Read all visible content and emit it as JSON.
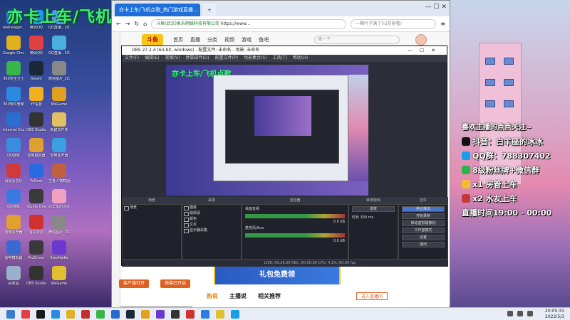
{
  "overlay": {
    "title": "亦卡上车/飞机点歌"
  },
  "desktop": {
    "icons": [
      {
        "label": "webviwger...",
        "color": "#2a7de1"
      },
      {
        "label": "腾讯QQ",
        "color": "#1a9de8"
      },
      {
        "label": "QQ直播...2021121...",
        "color": "#4aa0e0"
      },
      {
        "label": "Google Chrome",
        "color": "#e0b020"
      },
      {
        "label": "腾讯QQ",
        "color": "#e04040"
      },
      {
        "label": "QQ直播...2021121...",
        "color": "#4ab0e0"
      },
      {
        "label": "360安全卫士",
        "color": "#3ab54a"
      },
      {
        "label": "Steam",
        "color": "#1b2838"
      },
      {
        "label": "微信图片_2021...",
        "color": "#888888"
      },
      {
        "label": "360软件管家",
        "color": "#2a8ae0"
      },
      {
        "label": "YY语音",
        "color": "#f0b020"
      },
      {
        "label": "WeGame",
        "color": "#e0a020"
      },
      {
        "label": "Internet Explorer",
        "color": "#2a6ed0"
      },
      {
        "label": "OBS Studio",
        "color": "#333333"
      },
      {
        "label": "新建文件夹",
        "color": "#e0c060"
      },
      {
        "label": "QQ游戏",
        "color": "#3a8ee0"
      },
      {
        "label": "雷电模拟器",
        "color": "#e0a030"
      },
      {
        "label": "雷电多开器",
        "color": "#3aa0e0"
      },
      {
        "label": "网易云音乐",
        "color": "#d03a3a"
      },
      {
        "label": "ToDesk",
        "color": "#2a6ae0"
      },
      {
        "label": "王者人物截图",
        "color": "#c06040"
      },
      {
        "label": "QQ游戏",
        "color": "#3a7ae0"
      },
      {
        "label": "Studio One",
        "color": "#3a3a3a"
      },
      {
        "label": "白羊座的冰冰",
        "color": "#f0a0c0"
      },
      {
        "label": "雷电多开器",
        "color": "#e0a030"
      },
      {
        "label": "金舟录屏",
        "color": "#d03030"
      },
      {
        "label": "微信图片_2022030...",
        "color": "#888888"
      },
      {
        "label": "雷电模拟器",
        "color": "#3a6ad0"
      },
      {
        "label": "ProDriver",
        "color": "#3a3a3a"
      },
      {
        "label": "XiaoMaiKe",
        "color": "#6a3ad0"
      },
      {
        "label": "回收站",
        "color": "#9ab0c8"
      },
      {
        "label": "OBS Studio",
        "color": "#333333"
      },
      {
        "label": "WeGame",
        "color": "#e0c030"
      }
    ]
  },
  "browser": {
    "tab_active": "亦卡上车/飞机点歌_热门游戏直播...",
    "tab_inactive": "",
    "address": "https://www...",
    "address_prefix": "斗鱼(武汉)鱼乐网络科技有限公司",
    "search_placeholder": "一颗叶子满了(以防偷看)",
    "window_controls": "—  ☐  ✕",
    "site": {
      "logo": "斗鱼",
      "nav": [
        "首页",
        "直播",
        "分类",
        "视频",
        "游戏",
        "鱼吧"
      ],
      "search_placeholder": "搜一下",
      "bottom_tabs": [
        "热说",
        "主播说",
        "相关推荐"
      ],
      "hot_tab": "热说",
      "follow_btn": "进入直播间",
      "btn_a": "客户端打开",
      "btn_b": "弹幕已开启",
      "promo_text": "礼包免费领"
    }
  },
  "obs": {
    "title": "OBS 27.2.4 (64-bit, windows) - 配置文件: 未命名 - 场景: 未命名",
    "menu": [
      "文件(F)",
      "编辑(E)",
      "视图(V)",
      "停靠部件(D)",
      "配置文件(P)",
      "场景集合(S)",
      "工具(T)",
      "帮助(H)"
    ],
    "preview_title": "亦卡上车/飞机点歌",
    "dock_headers": {
      "scenes": "场景",
      "sources": "来源",
      "mixer": "混音器",
      "transitions": "转场特效",
      "controls": "控件"
    },
    "scene_items": [
      "场景"
    ],
    "source_items": [
      "图像",
      "视频源",
      "颜色",
      "文本",
      "显示器采集"
    ],
    "mixer_labels": [
      "桌面音频",
      "麦克风/Aux"
    ],
    "mixer_values": [
      "0.0 dB",
      "0.0 dB"
    ],
    "transition": {
      "type": "渐变",
      "duration_label": "时长",
      "duration_value": "300 ms"
    },
    "controls": [
      "停止推流",
      "开始录制",
      "启动虚拟摄像机",
      "工作室模式",
      "设置",
      "退出"
    ],
    "status": "LIVE: 00:26:26   REC: 00:00:00   CPU: 4.1%, 60.00 fps"
  },
  "streamer": {
    "lines": [
      "喜欢主播的点点关注~",
      "抖音：白羊座的冰冰",
      "QQ群：788307402",
      "8级粉丝牌+微信群",
      "x1 房管上车",
      "x2 水友上车",
      "直播时间19:00 - 00:00"
    ],
    "icon_colors": [
      "#000000",
      "#111111",
      "#1a9de8",
      "#2ab54a",
      "#f0c030",
      "#c03a3a",
      "#ffffff"
    ]
  },
  "taskbar": {
    "time": "20:05:31",
    "date": "2022/5/3",
    "icons": [
      "#3a7ad0",
      "#e04040",
      "#1a1a1a",
      "#2a8ae0",
      "#e0b020",
      "#c03030",
      "#3ab54a",
      "#2a6ad0",
      "#1b2838",
      "#e0a020",
      "#6a3ad0",
      "#333333",
      "#d03030",
      "#2a7de1",
      "#e0c030",
      "#1a9de8"
    ]
  }
}
